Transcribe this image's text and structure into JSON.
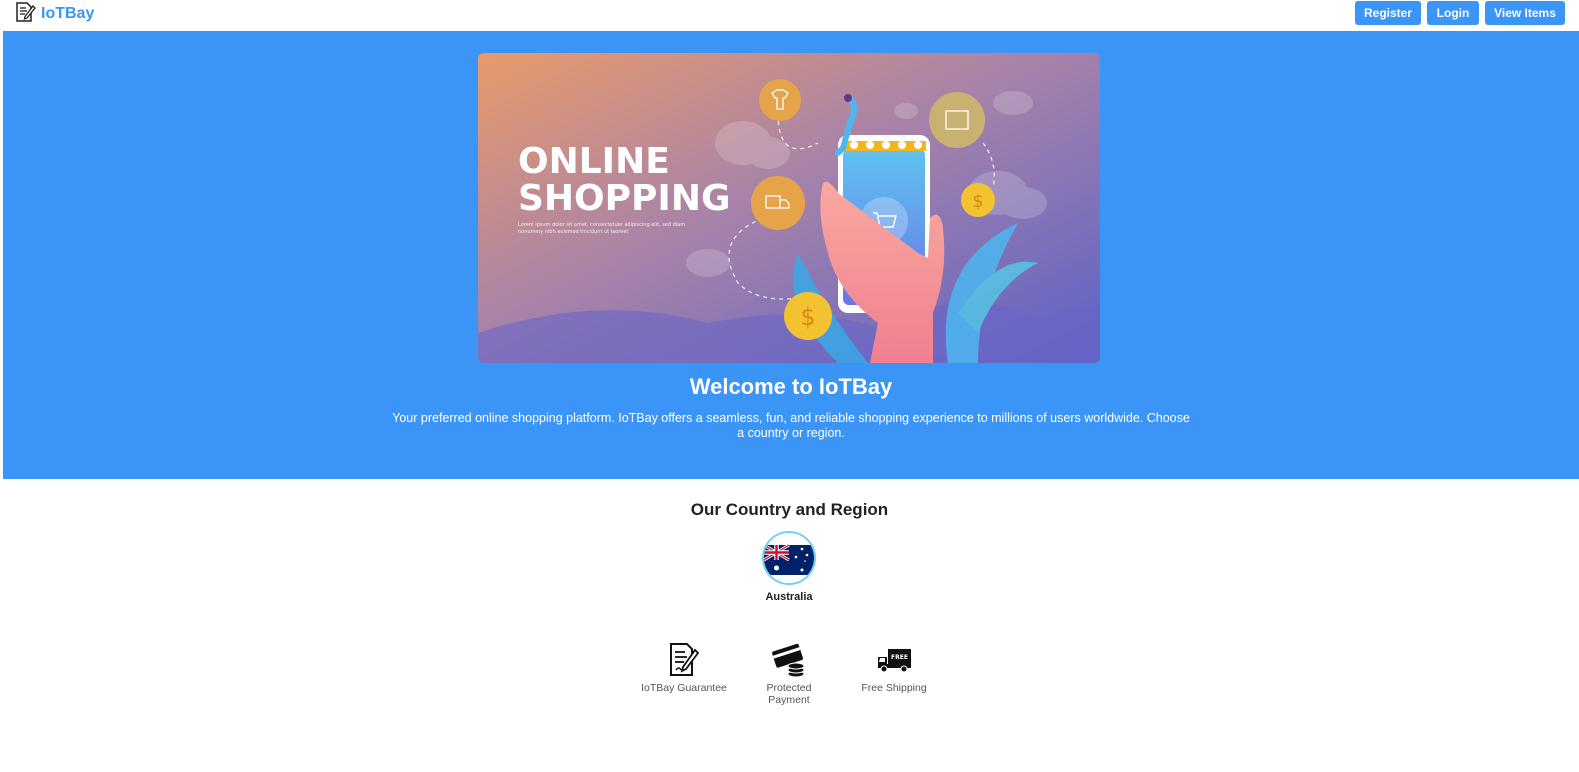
{
  "header": {
    "brand": "IoTBay",
    "buttons": {
      "register": "Register",
      "login": "Login",
      "view_items": "View Items"
    }
  },
  "hero": {
    "banner": {
      "headline_1": "ONLINE",
      "headline_2": "SHOPPING",
      "small_text_1": "Lorem ipsum dolor sit amet, consectetuer adipiscing elit, sed diam",
      "small_text_2": "nonummy nibh euismod tincidunt ut laoreet"
    },
    "title": "Welcome to IoTBay",
    "description": "Your preferred online shopping platform. IoTBay offers a seamless, fun, and reliable shopping experience to millions of users worldwide. Choose a country or region."
  },
  "region": {
    "title": "Our Country and Region",
    "country": "Australia"
  },
  "features": {
    "guarantee": "IoTBay Guarantee",
    "payment": "Protected Payment",
    "shipping": "Free Shipping",
    "shipping_badge": "FREE"
  },
  "colors": {
    "accent": "#3a95f7",
    "flag_ring": "#6fd3f2"
  }
}
